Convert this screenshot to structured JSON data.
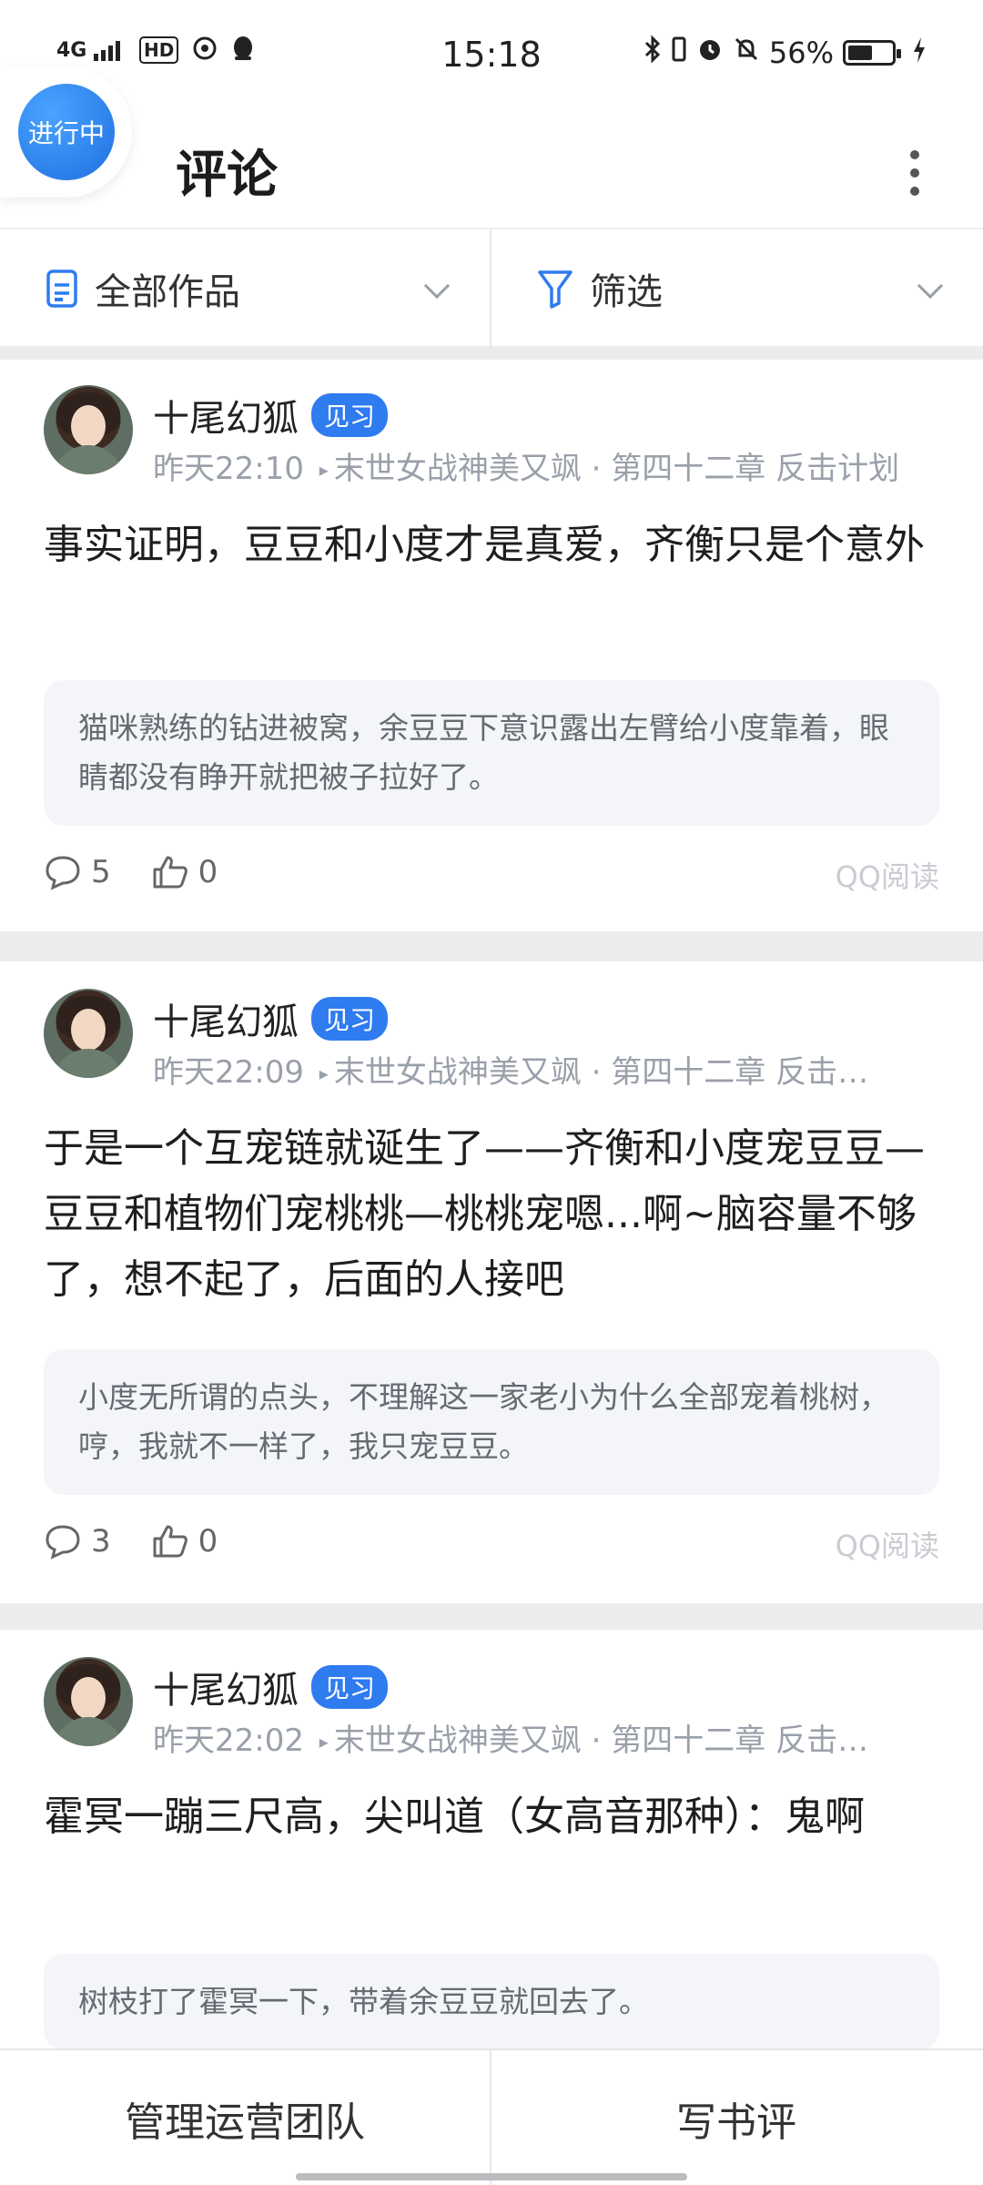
{
  "status_bar": {
    "network": "4G",
    "hd": "HD",
    "time": "15:18",
    "battery_percent": "56%",
    "battery_level": 0.56
  },
  "header": {
    "title": "评论",
    "floating_badge": "进行中"
  },
  "filters": {
    "works_label": "全部作品",
    "filter_label": "筛选"
  },
  "comments": [
    {
      "username": "十尾幻狐",
      "badge": "见习",
      "time": "昨天22:10",
      "book": "末世女战神美又飒",
      "chapter": "第四十二章 反击计划",
      "text": "事实证明，豆豆和小度才是真爱，齐衡只是个意外",
      "quote": "猫咪熟练的钻进被窝，余豆豆下意识露出左臂给小度靠着，眼睛都没有睁开就把被子拉好了。",
      "replies": "5",
      "likes": "0",
      "source": "QQ阅读"
    },
    {
      "username": "十尾幻狐",
      "badge": "见习",
      "time": "昨天22:09",
      "book": "末世女战神美又飒",
      "chapter": "第四十二章 反击…",
      "text": "于是一个互宠链就诞生了——齐衡和小度宠豆豆—豆豆和植物们宠桃桃—桃桃宠嗯...啊~脑容量不够了，想不起了，后面的人接吧",
      "quote": "小度无所谓的点头，不理解这一家老小为什么全部宠着桃树，哼，我就不一样了，我只宠豆豆。",
      "replies": "3",
      "likes": "0",
      "source": "QQ阅读"
    },
    {
      "username": "十尾幻狐",
      "badge": "见习",
      "time": "昨天22:02",
      "book": "末世女战神美又飒",
      "chapter": "第四十二章 反击…",
      "text": "霍冥一蹦三尺高，尖叫道（女高音那种）：鬼啊",
      "quote": "树枝打了霍冥一下，带着余豆豆就回去了。"
    }
  ],
  "bottom_bar": {
    "manage_team": "管理运营团队",
    "write_review": "写书评"
  }
}
